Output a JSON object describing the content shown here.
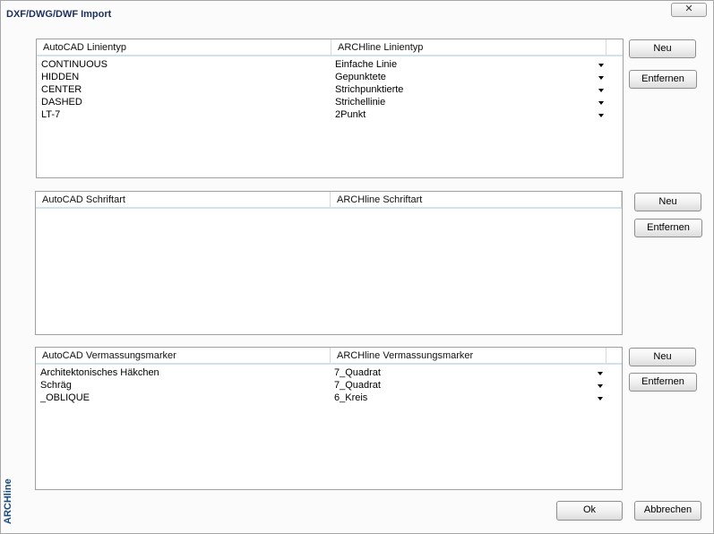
{
  "window": {
    "title": "DXF/DWG/DWF Import",
    "close_glyph": "✕",
    "brand": "ARCHline"
  },
  "linetypes": {
    "headers": [
      "AutoCAD Linientyp",
      "ARCHline Linientyp"
    ],
    "rows": [
      {
        "autocad": "CONTINUOUS",
        "archline": "Einfache Linie"
      },
      {
        "autocad": "HIDDEN",
        "archline": "Gepunktete"
      },
      {
        "autocad": "CENTER",
        "archline": "Strichpunktierte"
      },
      {
        "autocad": "DASHED",
        "archline": "Strichellinie"
      },
      {
        "autocad": "LT-7",
        "archline": "2Punkt"
      }
    ],
    "new_label": "Neu",
    "remove_label": "Entfernen"
  },
  "fonts": {
    "headers": [
      "AutoCAD Schriftart",
      "ARCHline Schriftart"
    ],
    "rows": [],
    "new_label": "Neu",
    "remove_label": "Entfernen"
  },
  "markers": {
    "headers": [
      "AutoCAD Vermassungsmarker",
      "ARCHline Vermassungsmarker"
    ],
    "rows": [
      {
        "autocad": "Architektonisches Häkchen",
        "archline": "7_Quadrat"
      },
      {
        "autocad": "Schräg",
        "archline": "7_Quadrat"
      },
      {
        "autocad": "_OBLIQUE",
        "archline": "6_Kreis"
      }
    ],
    "new_label": "Neu",
    "remove_label": "Entfernen"
  },
  "footer": {
    "ok_label": "Ok",
    "cancel_label": "Abbrechen"
  }
}
